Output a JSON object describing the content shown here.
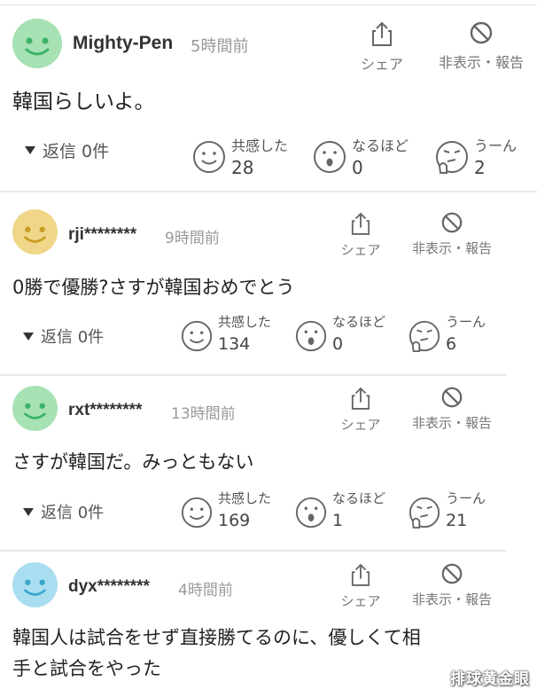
{
  "actions": {
    "share_label": "シェア",
    "hide_report_label": "非表示・報告"
  },
  "reply_label": "返信 0件",
  "reactions": {
    "empathy_label": "共感した",
    "insight_label": "なるほど",
    "hmm_label": "うーん"
  },
  "comments": [
    {
      "avatar_color": "#a6e2b3",
      "face_color": "#3cb267",
      "username": "Mighty-Pen",
      "time": "5時間前",
      "text": "韓国らしいよ。",
      "counts": {
        "empathy": "28",
        "insight": "0",
        "hmm": "2"
      }
    },
    {
      "avatar_color": "#f0d688",
      "face_color": "#c99b22",
      "username": "rji********",
      "time": "9時間前",
      "text": "0勝で優勝?さすが韓国おめでとう",
      "counts": {
        "empathy": "134",
        "insight": "0",
        "hmm": "6"
      }
    },
    {
      "avatar_color": "#a6e2b3",
      "face_color": "#3cb267",
      "username": "rxt********",
      "time": "13時間前",
      "text": "さすが韓国だ。みっともない",
      "counts": {
        "empathy": "169",
        "insight": "1",
        "hmm": "21"
      }
    },
    {
      "avatar_color": "#a9def0",
      "face_color": "#3aa6cc",
      "username": "dyx********",
      "time": "4時間前",
      "text_lines": [
        "韓国人は試合をせず直接勝てるのに、優しくて相",
        "手と試合をやった"
      ]
    }
  ],
  "watermark": "排球黄金眼"
}
